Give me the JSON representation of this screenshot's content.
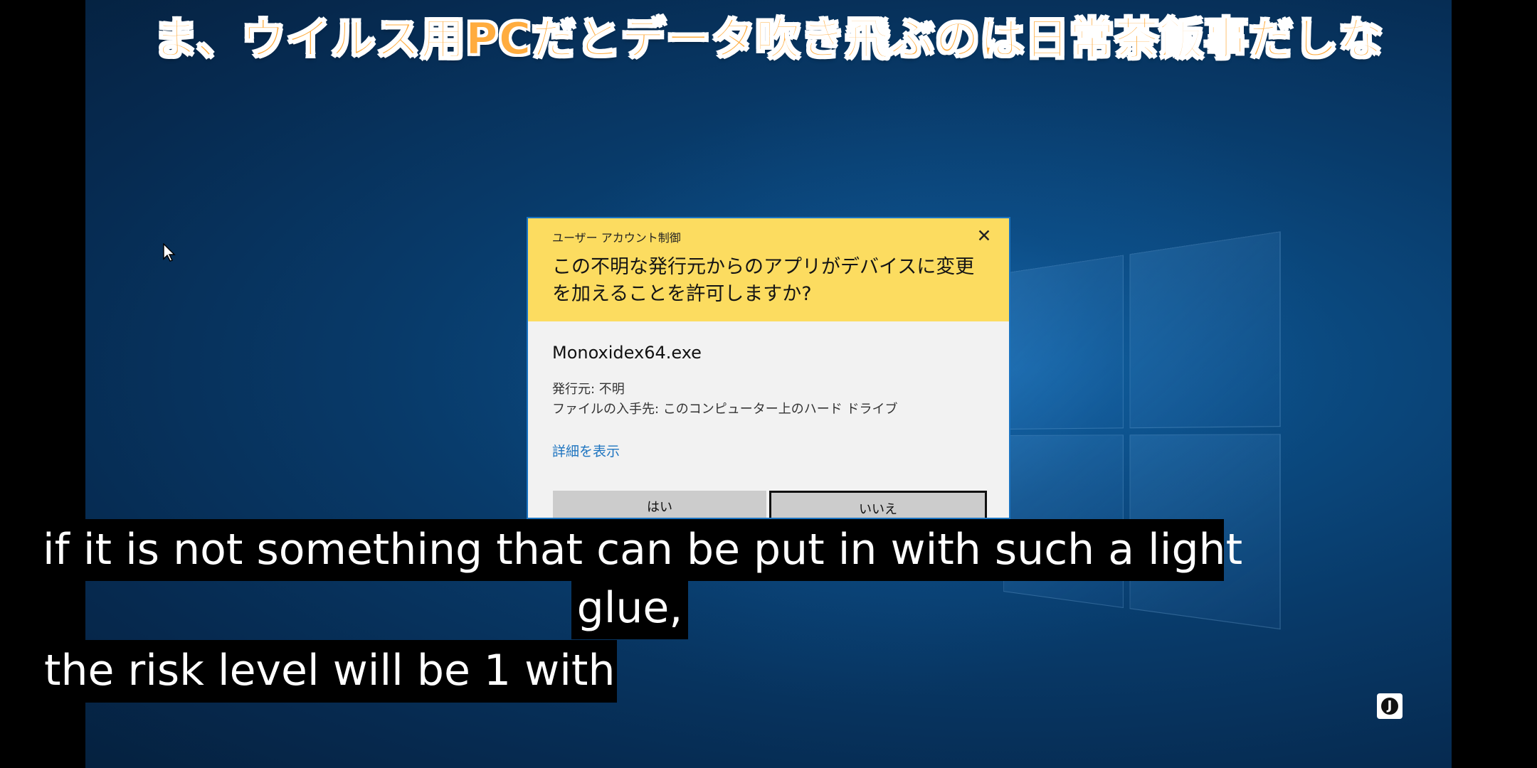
{
  "top_caption": "ま、ウイルス用PCだとデータ吹き飛ぶのは日常茶飯事だしな",
  "dialog": {
    "label": "ユーザー アカウント制御",
    "close_symbol": "✕",
    "question": "この不明な発行元からのアプリがデバイスに変更を加えることを許可しますか?",
    "file_name": "Monoxidex64.exe",
    "publisher": "発行元: 不明",
    "origin": "ファイルの入手先: このコンピューター上のハード ドライブ",
    "details_link": "詳細を表示",
    "yes_button": "はい",
    "no_button": "いいえ"
  },
  "subtitles": {
    "line1": "if it is not something that can be put in with such a light",
    "line2": "glue,",
    "line3": "the risk level will be 1 with"
  },
  "watermark": "J",
  "icons": [
    "mouse-pointer-icon",
    "close-icon",
    "windows-logo",
    "channel-watermark-icon"
  ],
  "colors": {
    "desktop": "#0b4b82",
    "dialog_header": "#fcdc60",
    "dialog_border": "#1b74c2",
    "link": "#1f75c0",
    "caption_orange": "#ffac3e",
    "subtitle_bg": "#000000",
    "subtitle_text": "#ffffff"
  }
}
